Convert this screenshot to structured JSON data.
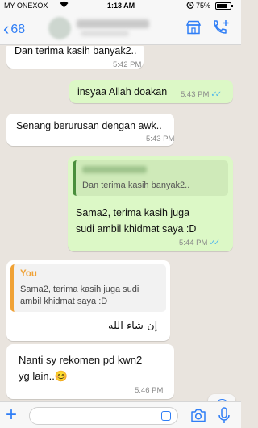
{
  "status_bar": {
    "carrier": "MY ONEXOX",
    "time": "1:13 AM",
    "battery_percent": "75%",
    "battery_level": 0.75,
    "icons": [
      "wifi-icon",
      "alarm-icon",
      "battery-icon"
    ]
  },
  "nav": {
    "back_count": "68",
    "icons": [
      "chevron-left-icon",
      "store-icon",
      "add-call-icon"
    ]
  },
  "messages": [
    {
      "direction": "in",
      "text": "Dan terima kasih banyak2..",
      "time": "5:42 PM"
    },
    {
      "direction": "out",
      "text": "insyaa Allah doakan",
      "time": "5:43 PM",
      "read": true
    },
    {
      "direction": "in",
      "text": "Senang berurusan dengan awk..",
      "time": "5:43 PM"
    },
    {
      "direction": "out",
      "quote": "Dan terima kasih banyak2..",
      "text": "Sama2, terima kasih juga sudi ambil khidmat saya :D",
      "time": "5:44 PM",
      "read": true
    },
    {
      "direction": "in",
      "quote_author": "You",
      "quote": "Sama2, terima kasih juga sudi ambil khidmat saya :D",
      "text": "إن شاء الله",
      "time": ""
    },
    {
      "direction": "in",
      "text": "Nanti sy rekomen pd kwn2 yg lain..😊",
      "time": "5:46 PM"
    }
  ],
  "input": {
    "placeholder": "",
    "icons": [
      "plus-icon",
      "sticker-icon",
      "camera-icon",
      "microphone-icon"
    ]
  },
  "colors": {
    "accent": "#2f7ef6",
    "outgoing_bubble": "#dcf8c6",
    "incoming_bubble": "#ffffff",
    "quote_bar_you": "#f0a236",
    "read_ticks": "#4fb6ec"
  }
}
